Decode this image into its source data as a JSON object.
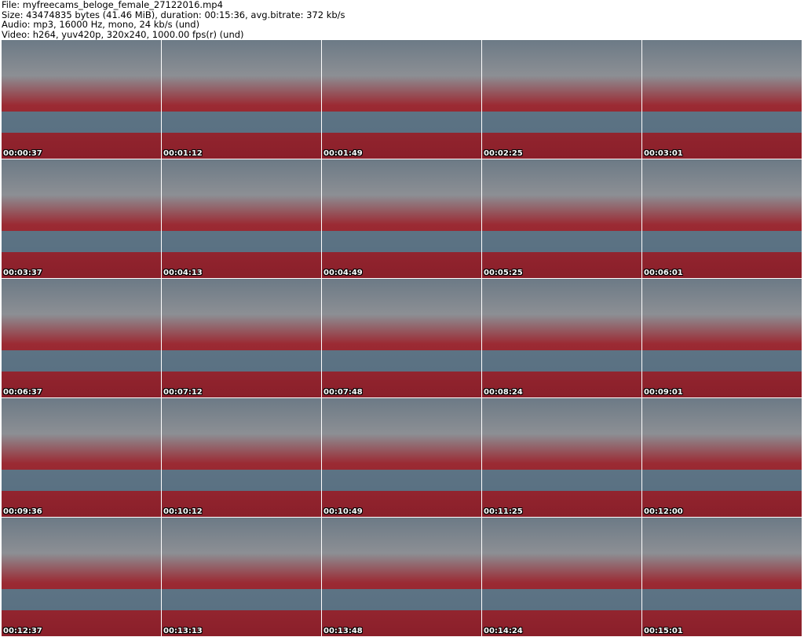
{
  "header": {
    "file": "File: myfreecams_beloge_female_27122016.mp4",
    "size": "Size: 43474835 bytes (41.46 MiB), duration: 00:15:36, avg.bitrate: 372 kb/s",
    "audio": "Audio: mp3, 16000 Hz, mono, 24 kb/s (und)",
    "video": "Video: h264, yuv420p, 320x240, 1000.00 fps(r) (und)"
  },
  "thumbnails": [
    "00:00:37",
    "00:01:12",
    "00:01:49",
    "00:02:25",
    "00:03:01",
    "00:03:37",
    "00:04:13",
    "00:04:49",
    "00:05:25",
    "00:06:01",
    "00:06:37",
    "00:07:12",
    "00:07:48",
    "00:08:24",
    "00:09:01",
    "00:09:36",
    "00:10:12",
    "00:10:49",
    "00:11:25",
    "00:12:00",
    "00:12:37",
    "00:13:13",
    "00:13:48",
    "00:14:24",
    "00:15:01"
  ]
}
